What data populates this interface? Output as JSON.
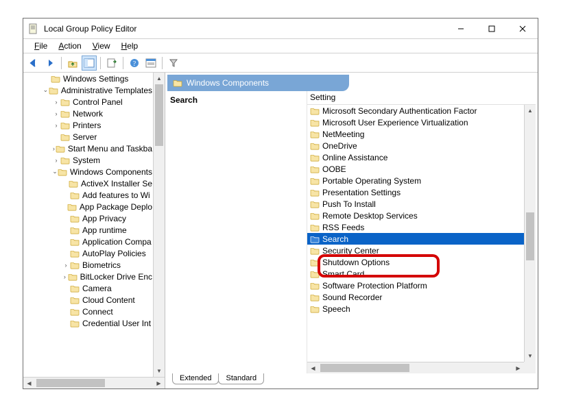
{
  "window": {
    "title": "Local Group Policy Editor"
  },
  "menu": {
    "file": "File",
    "action": "Action",
    "view": "View",
    "help": "Help"
  },
  "tree": {
    "items": [
      {
        "indent": 2,
        "toggle": "",
        "open": false,
        "label": "Windows Settings"
      },
      {
        "indent": 2,
        "toggle": "v",
        "open": true,
        "label": "Administrative Templates"
      },
      {
        "indent": 3,
        "toggle": ">",
        "open": false,
        "label": "Control Panel"
      },
      {
        "indent": 3,
        "toggle": ">",
        "open": false,
        "label": "Network"
      },
      {
        "indent": 3,
        "toggle": ">",
        "open": false,
        "label": "Printers"
      },
      {
        "indent": 3,
        "toggle": "",
        "open": false,
        "label": "Server"
      },
      {
        "indent": 3,
        "toggle": ">",
        "open": false,
        "label": "Start Menu and Taskba"
      },
      {
        "indent": 3,
        "toggle": ">",
        "open": false,
        "label": "System"
      },
      {
        "indent": 3,
        "toggle": "v",
        "open": true,
        "label": "Windows Components"
      },
      {
        "indent": 4,
        "toggle": "",
        "open": false,
        "label": "ActiveX Installer Se"
      },
      {
        "indent": 4,
        "toggle": "",
        "open": false,
        "label": "Add features to Wi"
      },
      {
        "indent": 4,
        "toggle": "",
        "open": false,
        "label": "App Package Deplo"
      },
      {
        "indent": 4,
        "toggle": "",
        "open": false,
        "label": "App Privacy"
      },
      {
        "indent": 4,
        "toggle": "",
        "open": false,
        "label": "App runtime"
      },
      {
        "indent": 4,
        "toggle": "",
        "open": false,
        "label": "Application Compa"
      },
      {
        "indent": 4,
        "toggle": "",
        "open": false,
        "label": "AutoPlay Policies"
      },
      {
        "indent": 4,
        "toggle": ">",
        "open": false,
        "label": "Biometrics"
      },
      {
        "indent": 4,
        "toggle": ">",
        "open": false,
        "label": "BitLocker Drive Enc"
      },
      {
        "indent": 4,
        "toggle": "",
        "open": false,
        "label": "Camera"
      },
      {
        "indent": 4,
        "toggle": "",
        "open": false,
        "label": "Cloud Content"
      },
      {
        "indent": 4,
        "toggle": "",
        "open": false,
        "label": "Connect"
      },
      {
        "indent": 4,
        "toggle": "",
        "open": false,
        "label": "Credential User Int"
      }
    ]
  },
  "right": {
    "header": "Windows Components",
    "left_title": "Search",
    "column": "Setting",
    "items": [
      {
        "label": "Microsoft Secondary Authentication Factor",
        "selected": false
      },
      {
        "label": "Microsoft User Experience Virtualization",
        "selected": false
      },
      {
        "label": "NetMeeting",
        "selected": false
      },
      {
        "label": "OneDrive",
        "selected": false
      },
      {
        "label": "Online Assistance",
        "selected": false
      },
      {
        "label": "OOBE",
        "selected": false
      },
      {
        "label": "Portable Operating System",
        "selected": false
      },
      {
        "label": "Presentation Settings",
        "selected": false
      },
      {
        "label": "Push To Install",
        "selected": false
      },
      {
        "label": "Remote Desktop Services",
        "selected": false
      },
      {
        "label": "RSS Feeds",
        "selected": false
      },
      {
        "label": "Search",
        "selected": true
      },
      {
        "label": "Security Center",
        "selected": false
      },
      {
        "label": "Shutdown Options",
        "selected": false
      },
      {
        "label": "Smart Card",
        "selected": false
      },
      {
        "label": "Software Protection Platform",
        "selected": false
      },
      {
        "label": "Sound Recorder",
        "selected": false
      },
      {
        "label": "Speech",
        "selected": false
      }
    ]
  },
  "tabs": {
    "extended": "Extended",
    "standard": "Standard"
  }
}
